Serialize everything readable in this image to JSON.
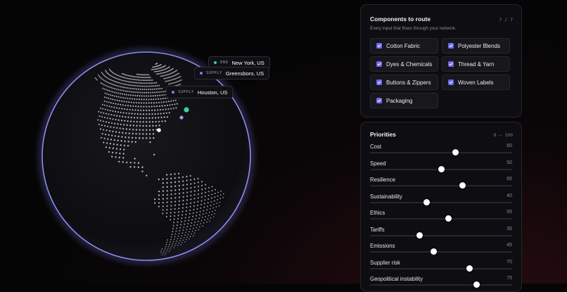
{
  "locations": [
    {
      "tag": "END",
      "name": "New York, US",
      "color": "#3ad3a0"
    },
    {
      "tag": "SUPPLY",
      "name": "Greensboro, US",
      "color": "#7d7df0"
    },
    {
      "tag": "SUPPLY",
      "name": "Houston, US",
      "color": "#7d7df0"
    }
  ],
  "components": {
    "title": "Components to route",
    "count": "7 / 7",
    "subtitle": "Every input that flows through your network.",
    "items": [
      {
        "label": "Cotton Fabric",
        "checked": true
      },
      {
        "label": "Polyester Blends",
        "checked": true
      },
      {
        "label": "Dyes & Chemicals",
        "checked": true
      },
      {
        "label": "Thread & Yarn",
        "checked": true
      },
      {
        "label": "Buttons & Zippers",
        "checked": true
      },
      {
        "label": "Woven Labels",
        "checked": true
      },
      {
        "label": "Packaging",
        "checked": true
      }
    ]
  },
  "priorities": {
    "title": "Priorities",
    "range": "0 – 100",
    "items": [
      {
        "label": "Cost",
        "value": 60
      },
      {
        "label": "Speed",
        "value": 50
      },
      {
        "label": "Resilience",
        "value": 65
      },
      {
        "label": "Sustainability",
        "value": 40
      },
      {
        "label": "Ethics",
        "value": 55
      },
      {
        "label": "Tariffs",
        "value": 35
      },
      {
        "label": "Emissions",
        "value": 45
      },
      {
        "label": "Supplier risk",
        "value": 70
      },
      {
        "label": "Geopolitical instability",
        "value": 75
      }
    ]
  },
  "colors": {
    "accent": "#6f6cf2",
    "globe_rim": "#8e8cf0",
    "dot": "#cfcfd8"
  }
}
